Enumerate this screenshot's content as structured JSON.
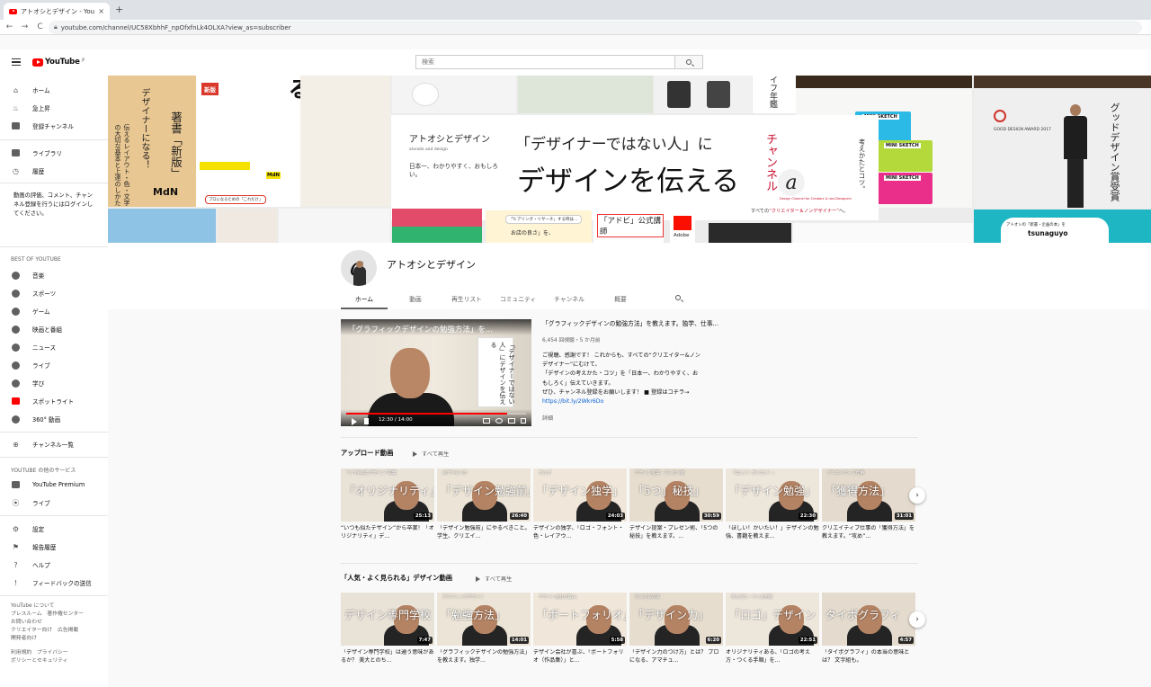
{
  "browser": {
    "tab_title": "アトオシとデザイン - YouTube",
    "tab_close": "×",
    "new_tab": "+",
    "url": "youtube.com/channel/UC58XbhhF_npOfxfnLk4OLXA?view_as=subscriber",
    "back": "←",
    "forward": "→",
    "reload": "C"
  },
  "header": {
    "logo_text": "YouTube",
    "logo_region": "JP",
    "search_placeholder": "検索"
  },
  "sidebar": {
    "main": [
      {
        "label": "ホーム",
        "icon": "home-icon"
      },
      {
        "label": "急上昇",
        "icon": "flame-icon"
      },
      {
        "label": "登録チャンネル",
        "icon": "subscriptions-icon"
      }
    ],
    "library": [
      {
        "label": "ライブラリ",
        "icon": "library-icon"
      },
      {
        "label": "履歴",
        "icon": "history-icon"
      }
    ],
    "signin_text": "動画の評価、コメント、チャンネル登録を行うにはログインしてください。",
    "best_heading": "BEST OF YOUTUBE",
    "best": [
      {
        "label": "音楽",
        "icon": "music-icon"
      },
      {
        "label": "スポーツ",
        "icon": "sports-icon"
      },
      {
        "label": "ゲーム",
        "icon": "gaming-icon"
      },
      {
        "label": "映画と番組",
        "icon": "movies-icon"
      },
      {
        "label": "ニュース",
        "icon": "news-icon"
      },
      {
        "label": "ライブ",
        "icon": "live-icon"
      },
      {
        "label": "学び",
        "icon": "learning-icon"
      },
      {
        "label": "スポットライト",
        "icon": "spotlight-icon"
      },
      {
        "label": "360° 動画",
        "icon": "vr-icon"
      }
    ],
    "browse": {
      "label": "チャンネル一覧",
      "icon": "add-circle-icon"
    },
    "more_heading": "YOUTUBE の他のサービス",
    "more": [
      {
        "label": "YouTube Premium",
        "icon": "premium-icon"
      },
      {
        "label": "ライブ",
        "icon": "live-broadcast-icon"
      }
    ],
    "settings": [
      {
        "label": "設定",
        "icon": "gear-icon"
      },
      {
        "label": "報告履歴",
        "icon": "flag-icon"
      },
      {
        "label": "ヘルプ",
        "icon": "help-icon"
      },
      {
        "label": "フィードバックの送信",
        "icon": "feedback-icon"
      }
    ],
    "footer": [
      "YouTube について",
      "プレスルーム　著作権センター",
      "お問い合わせ",
      "クリエイター向け　広告掲載",
      "開発者向け",
      "",
      "利用規約　プライバシー",
      "ポリシーとセキュリティ"
    ]
  },
  "banner": {
    "channel_name": "アトオシとデザイン",
    "channel_sub": "atooshi and design",
    "slogan": "日本一、わかりやすく、おもしろい。",
    "headline1": "「デザイナーではない人」に",
    "headline2": "デザインを伝える",
    "channel_word": "チャンネル",
    "tagline_pre": "すべての",
    "tagline_hl": "“クリエイター＆ノンデザイナー”",
    "tagline_post": "へ。",
    "logo_caption": "Design Channel for Creators & non-Designers",
    "vertical_text": "考えかたとコツ。",
    "book_title": "イナーになる！",
    "book_new": "新版",
    "book_mdn": "MdN",
    "book_pro": "プロになるための「これだけ」",
    "wood_author": "著書「新版」",
    "wood_book": "デザイナーになる！",
    "wood_desc": "伝えるレイアウト・色・文字の大切な基本と上達のしかた",
    "wood_mdn": "MdN",
    "nenkan": "イフ年鑑",
    "gd_title": "グッドデザイン賞受賞",
    "gd_award": "GOOD DESIGN AWARD 2017",
    "tsun_t1": "アトオシの「新書・企画の本」を",
    "tsun_t2": "tsunaguyo",
    "adobe_label": "「アドビ」公式講師",
    "adobe_name": "Adobe",
    "hira_bubble": "「ヒアリング・リサーチ」する時は…",
    "hira_text": "お店の良さ」を、",
    "sketch1": "MINI SKETCH",
    "sketch2": "MINI SKETCH",
    "sketch3": "MINI SKETCH"
  },
  "channel": {
    "name": "アトオシとデザイン",
    "tabs": [
      "ホーム",
      "動画",
      "再生リスト",
      "コミュニティ",
      "チャンネル",
      "概要"
    ]
  },
  "featured": {
    "thumb_title": "「グラフィックデザインの勉強方法」を...",
    "book_text": "「デザイナーではない人」にデザインを伝える",
    "time": "12:30 / 14:00",
    "progress": 0.893,
    "title": "「グラフィックデザインの勉強方法」を教えます。独学、仕事...",
    "meta": "6,454 回視聴・5 か月前",
    "desc": [
      "ご視聴、感謝です！ これからも、すべての“クリエイター&ノン",
      "デザイナー”にむけて、",
      "「デザインの考えかた・コツ」を「日本一、わかりやすく、お",
      "もしろく」伝えていきます。",
      "ぜひ、チャンネル登録をお願いします！ ■ 登録はコチラ→"
    ],
    "link": "https://bit.ly/2Wkr6Do",
    "more": "詳細"
  },
  "uploads": {
    "title": "アップロード動画",
    "play_all": "すべて再生",
    "videos": [
      {
        "big": "「オリジナリティ」",
        "small": "“いつも似たデザイン”卒業",
        "dur": "25:13",
        "title": "“いつも似たデザイン”から卒業！「オリジナリティ」デ..."
      },
      {
        "big": "「デザイン勉強前」",
        "small": "必ずやるべき",
        "dur": "26:40",
        "title": "「デザイン勉強前」にやるべきこと。学生、クリエイ..."
      },
      {
        "big": "「デザイン独学」",
        "small": "ガルポ",
        "dur": "24:03",
        "title": "デザインの独学、「ロゴ・フォント・色・レイアウ..."
      },
      {
        "big": "「5つ」秘技」",
        "small": "デザイン提案・プレゼン術",
        "dur": "30:59",
        "title": "デザイン提案・プレゼン術、「5つの秘技」を教えます。..."
      },
      {
        "big": "「デザイン勉強」",
        "small": "「ほしい！かいたい！」",
        "dur": "22:30",
        "title": "「ほしい！かいたい！」デザインの勉強、書籍を教えま..."
      },
      {
        "big": "「獲得方法」",
        "small": "クリエイティブ仕事",
        "dur": "31:01",
        "title": "クリエイティブ仕事の「獲得方法」を教えます。“攻め”..."
      }
    ]
  },
  "popular": {
    "title": "「人気・よく見られる」デザイン動画",
    "play_all": "すべて再生",
    "videos": [
      {
        "big": "デザイン専門学校",
        "small": "",
        "dur": "7:47",
        "title": "「デザイン専門学校」は通う意味があるか？ 美大とのち..."
      },
      {
        "big": "「勉強方法」",
        "small": "グラフィックデザイン",
        "dur": "14:01",
        "title": "「グラフィックデザインの勉強方法」を教えます。独学..."
      },
      {
        "big": "「ポートフォリオ」",
        "small": "デザイン会社が喜ぶ、",
        "dur": "5:58",
        "title": "デザイン会社が喜ぶ、「ポートフォリオ（作品集）」と..."
      },
      {
        "big": "「デザイン力」",
        "small": "をつける方法",
        "dur": "6:20",
        "title": "「デザイン力のつけ方」とは？ プロになる、アマチュ..."
      },
      {
        "big": "「ロゴ」デザイン",
        "small": "考えかた・つくる手順",
        "dur": "22:51",
        "title": "オリジナリティある、「ロゴの考え方・つくる手順」を..."
      },
      {
        "big": "タイポグラフィ",
        "small": "",
        "dur": "4:57",
        "title": "「タイポグラフィ」の本当の意味とは？ 文字組も。"
      }
    ]
  },
  "carousel_next": "›"
}
